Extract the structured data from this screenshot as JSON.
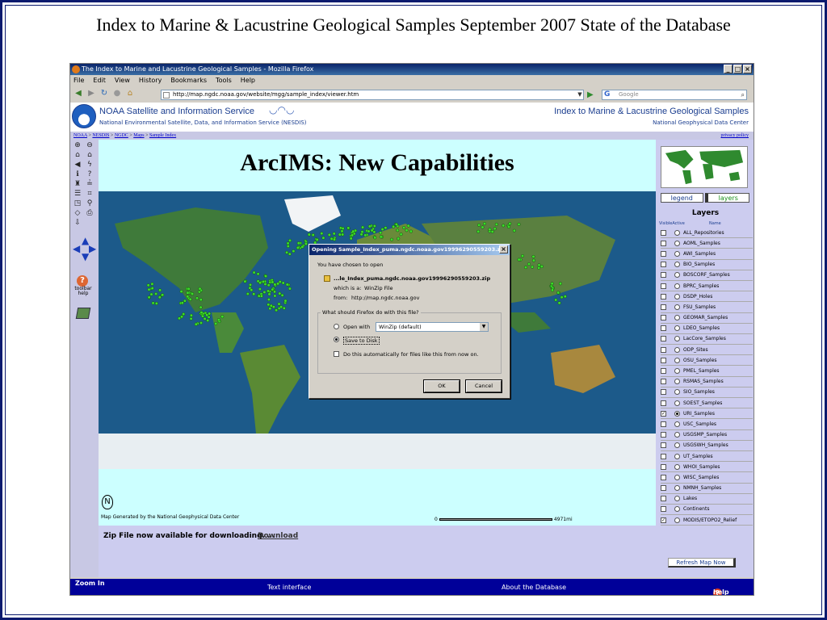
{
  "slide": {
    "title": "Index to Marine & Lacustrine Geological Samples September 2007 State of the Database"
  },
  "browser": {
    "window_title": "The Index to Marine and Lacustrine Geological Samples - Mozilla Firefox",
    "window_buttons": [
      "_",
      "□",
      "×"
    ],
    "menu": [
      "File",
      "Edit",
      "View",
      "History",
      "Bookmarks",
      "Tools",
      "Help"
    ],
    "url": "http://map.ngdc.noaa.gov/website/mgg/sample_index/viewer.htm",
    "search_placeholder": "Google",
    "search_engine_letter": "G"
  },
  "banner": {
    "left_title": "NOAA Satellite and Information Service",
    "left_subtitle": "National Environmental Satellite, Data, and Information Service (NESDIS)",
    "right_title": "Index to Marine & Lacustrine Geological Samples",
    "right_subtitle": "National Geophysical Data Center"
  },
  "breadcrumb": {
    "items": [
      "NOAA",
      "NESDIS",
      "NGDC",
      "Maps",
      "Sample Index"
    ],
    "separator": ">",
    "privacy": "privacy policy"
  },
  "toolbar": {
    "help_label_1": "toolbar",
    "help_label_2": "help"
  },
  "map": {
    "title": "ArcIMS: New Capabilities",
    "credit": "Map Generated by the National Geophysical Data Center",
    "scale_start": "0",
    "scale_end": "4971mi",
    "compass_letter": "N",
    "zip_message": "Zip File now available for downloading. . .",
    "download_label": "Download"
  },
  "dialog": {
    "title": "Opening Sample_Index_puma.ngdc.noaa.gov19996290559203.zip",
    "close": "×",
    "intro": "You have chosen to open",
    "filename": "...le_Index_puma.ngdc.noaa.gov19996290559203.zip",
    "which_is_label": "which is a:",
    "which_is_value": "WinZip File",
    "from_label": "from:",
    "from_value": "http://map.ngdc.noaa.gov",
    "group_label": "What should Firefox do with this file?",
    "open_with_label": "Open with",
    "open_with_value": "WinZip (default)",
    "open_with_selected": false,
    "save_label": "Save to Disk",
    "save_selected": true,
    "auto_label": "Do this automatically for files like this from now on.",
    "auto_checked": false,
    "ok_label": "OK",
    "cancel_label": "Cancel"
  },
  "right_panel": {
    "tab_legend": "legend",
    "tab_layers": "layers",
    "layers_heading": "Layers",
    "col_visible": "Visible",
    "col_active": "Active",
    "col_name": "Name",
    "layers": [
      {
        "name": "ALL_Repositories",
        "visible": false,
        "active": false
      },
      {
        "name": "AOML_Samples",
        "visible": false,
        "active": false
      },
      {
        "name": "AWI_Samples",
        "visible": false,
        "active": false
      },
      {
        "name": "BIO_Samples",
        "visible": false,
        "active": false
      },
      {
        "name": "BOSCORF_Samples",
        "visible": false,
        "active": false
      },
      {
        "name": "BPRC_Samples",
        "visible": false,
        "active": false
      },
      {
        "name": "DSDP_Holes",
        "visible": false,
        "active": false
      },
      {
        "name": "FSU_Samples",
        "visible": false,
        "active": false
      },
      {
        "name": "GEOMAR_Samples",
        "visible": false,
        "active": false
      },
      {
        "name": "LDEO_Samples",
        "visible": false,
        "active": false
      },
      {
        "name": "LacCore_Samples",
        "visible": false,
        "active": false
      },
      {
        "name": "ODP_Sites",
        "visible": false,
        "active": false
      },
      {
        "name": "OSU_Samples",
        "visible": false,
        "active": false
      },
      {
        "name": "PMEL_Samples",
        "visible": false,
        "active": false
      },
      {
        "name": "RSMAS_Samples",
        "visible": false,
        "active": false
      },
      {
        "name": "SIO_Samples",
        "visible": false,
        "active": false
      },
      {
        "name": "SOEST_Samples",
        "visible": false,
        "active": false
      },
      {
        "name": "URI_Samples",
        "visible": true,
        "active": true
      },
      {
        "name": "USC_Samples",
        "visible": false,
        "active": false
      },
      {
        "name": "USGSMP_Samples",
        "visible": false,
        "active": false
      },
      {
        "name": "USGSWH_Samples",
        "visible": false,
        "active": false
      },
      {
        "name": "UT_Samples",
        "visible": false,
        "active": false
      },
      {
        "name": "WHOI_Samples",
        "visible": false,
        "active": false
      },
      {
        "name": "WISC_Samples",
        "visible": false,
        "active": false
      },
      {
        "name": "NMNH_Samples",
        "visible": false,
        "active": false
      },
      {
        "name": "Lakes",
        "visible": false,
        "active": false
      },
      {
        "name": "Continents",
        "visible": false,
        "active": false
      },
      {
        "name": "MODIS/ETOPO2_Relief",
        "visible": true,
        "active": false
      }
    ],
    "refresh_label": "Refresh Map Now"
  },
  "bottom_bar": {
    "zoom": "Zoom In",
    "text_interface": "Text interface",
    "about": "About the Database",
    "help": "help",
    "help_icon": "?"
  },
  "colors": {
    "frame": "#0b1a6e",
    "noaa_blue": "#1a3d8f",
    "bottom_bar": "#000099",
    "ocean": "#1c5a8a",
    "land": "#3f7a3a",
    "sample_dot": "#3cdc28"
  }
}
